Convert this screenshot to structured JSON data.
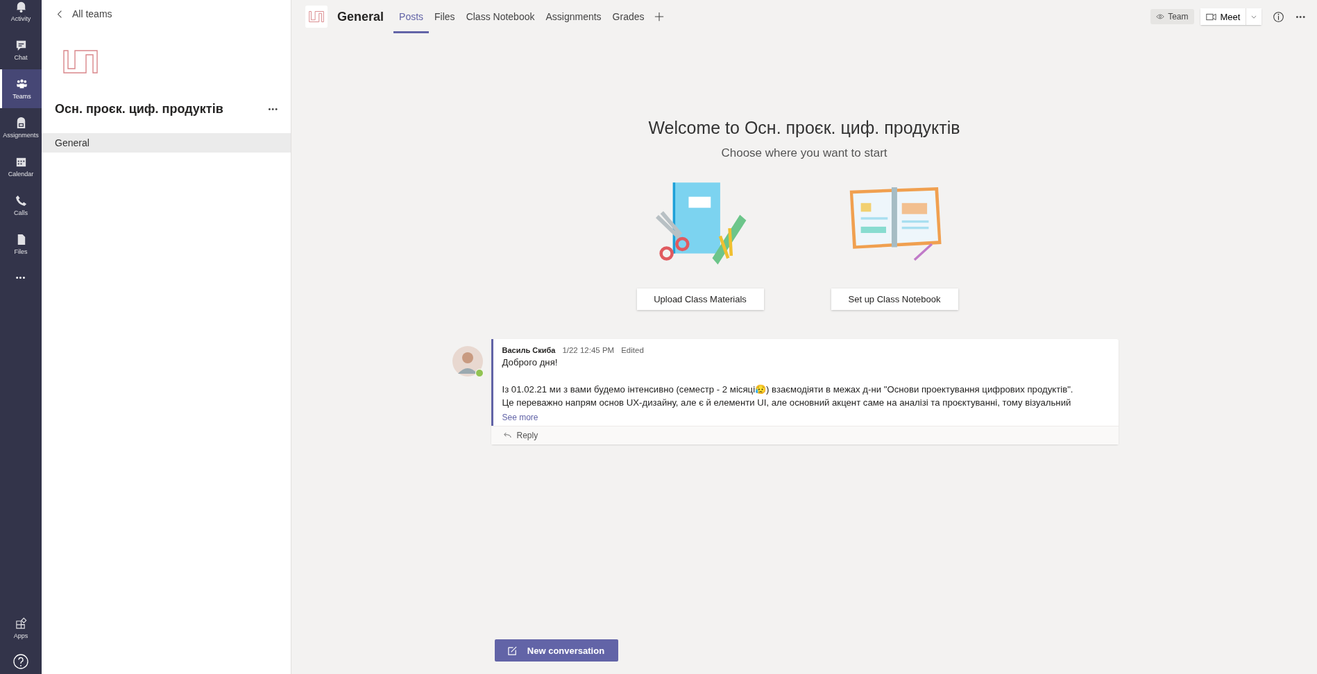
{
  "rail": {
    "items": [
      {
        "label": "Activity",
        "selected": false
      },
      {
        "label": "Chat",
        "selected": false
      },
      {
        "label": "Teams",
        "selected": true
      },
      {
        "label": "Assignments",
        "selected": false
      },
      {
        "label": "Calendar",
        "selected": false
      },
      {
        "label": "Calls",
        "selected": false
      },
      {
        "label": "Files",
        "selected": false
      }
    ],
    "more": "•••",
    "apps": "Apps"
  },
  "sidebar": {
    "back": "All teams",
    "team_name": "Осн. проєк. циф. продуктів",
    "more": "•••",
    "channels": [
      {
        "label": "General",
        "selected": true
      }
    ]
  },
  "header": {
    "channel": "General",
    "tabs": [
      {
        "label": "Posts",
        "selected": true
      },
      {
        "label": "Files",
        "selected": false
      },
      {
        "label": "Class Notebook",
        "selected": false
      },
      {
        "label": "Assignments",
        "selected": false
      },
      {
        "label": "Grades",
        "selected": false
      }
    ],
    "team_button": "Team",
    "meet_button": "Meet",
    "more": "•••"
  },
  "welcome": {
    "title": "Welcome to Осн. проєк. циф. продуктів",
    "subtitle": "Choose where you want to start",
    "actions": [
      {
        "kind": "materials",
        "label": "Upload Class Materials"
      },
      {
        "kind": "notebook",
        "label": "Set up Class Notebook"
      }
    ]
  },
  "posts": [
    {
      "author": "Василь Скиба",
      "time": "1/22 12:45 PM",
      "edited": "Edited",
      "greeting": "Доброго дня!",
      "lines": [
        "Із 01.02.21 ми з вами будемо інтенсивно (семестр - 2 місяці😥) взаємодіяти в межах д-ни \"Основи проектування цифрових продуктів\".",
        "Це переважно напрям основ UX-дизайну, але є й елементи UI, але основний акцент саме на аналізі та проєктуванні, тому візуальний"
      ],
      "see_more": "See more",
      "reply": "Reply"
    }
  ],
  "new_conversation": "New conversation"
}
